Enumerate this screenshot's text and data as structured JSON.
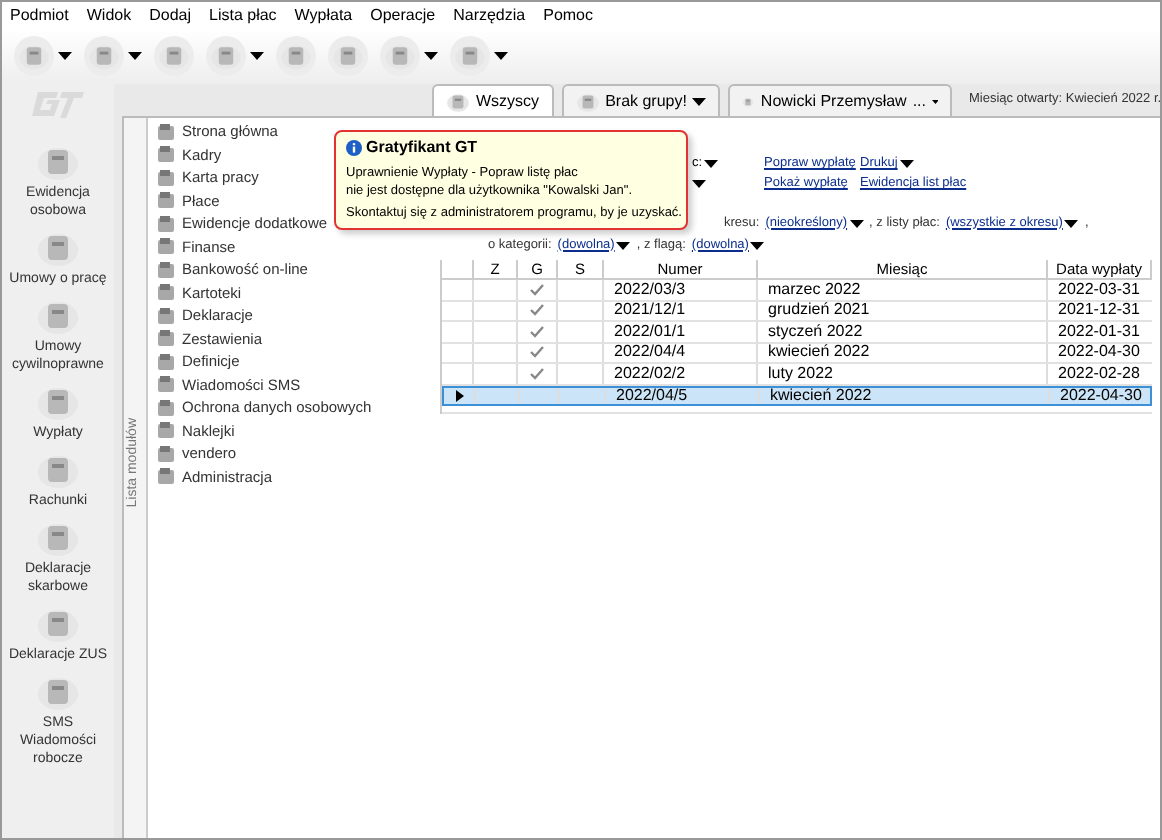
{
  "menu": [
    "Podmiot",
    "Widok",
    "Dodaj",
    "Lista płac",
    "Wypłata",
    "Operacje",
    "Narzędzia",
    "Pomoc"
  ],
  "tabs": [
    {
      "label": "Wszyscy",
      "selected": true,
      "dropdown": false
    },
    {
      "label": "Brak grupy!",
      "selected": false,
      "dropdown": true
    },
    {
      "label": "Nowicki Przemysław",
      "selected": false,
      "dropdown": true,
      "ellipsis": "..."
    }
  ],
  "open_month": "Miesiąc otwarty: Kwiecień 2022 r.",
  "left_nav": [
    "Ewidencja osobowa",
    "Umowy o pracę",
    "Umowy cywilnoprawne",
    "Wypłaty",
    "Rachunki",
    "Deklaracje skarbowe",
    "Deklaracje ZUS",
    "SMS Wiadomości robocze"
  ],
  "module_strip": {
    "label": "Lista modułów"
  },
  "modules": [
    "Strona główna",
    "Kadry",
    "Karta pracy",
    "Płace",
    "Ewidencje dodatkowe",
    "Finanse",
    "Bankowość on-line",
    "Kartoteki",
    "Deklaracje",
    "Zestawienia",
    "Definicje",
    "Wiadomości SMS",
    "Ochrona danych osobowych",
    "Naklejki",
    "vendero",
    "Administracja"
  ],
  "tooltip": {
    "title": "Gratyfikant GT",
    "message": "Uprawnienie Wypłaty - Popraw listę płac\nnie jest dostępne dla użytkownika \"Kowalski Jan\".",
    "hint": "Skontaktuj się z administratorem programu, by je uzyskać."
  },
  "actions": [
    {
      "partial": "c:",
      "links": [
        "Popraw wypłatę",
        "Drukuj"
      ]
    },
    {
      "links": [
        "Pokaż wypłatę",
        "Ewidencja list płac"
      ]
    }
  ],
  "filters": [
    [
      {
        "kind": "label",
        "text": "kresu:"
      },
      {
        "kind": "dropdown",
        "text": "(nieokreślony)"
      },
      {
        "kind": "label",
        "text": ", z listy płac:"
      },
      {
        "kind": "dropdown",
        "text": "(wszystkie z okresu)"
      },
      {
        "kind": "label",
        "text": ","
      }
    ],
    [
      {
        "kind": "label",
        "text": "o kategorii:"
      },
      {
        "kind": "dropdown",
        "text": "(dowolna)"
      },
      {
        "kind": "label",
        "text": ", z flagą:"
      },
      {
        "kind": "dropdown",
        "text": "(dowolna)"
      }
    ]
  ],
  "table": {
    "columns": [
      "Z",
      "G",
      "S",
      "Numer",
      "Miesiąc",
      "Data wypłaty"
    ],
    "rows": [
      {
        "g_checked": true,
        "numer": "2022/03/3",
        "miesiac": "marzec 2022",
        "data": "2022-03-31",
        "selected": false
      },
      {
        "g_checked": true,
        "numer": "2021/12/1",
        "miesiac": "grudzień 2021",
        "data": "2021-12-31",
        "selected": false
      },
      {
        "g_checked": true,
        "numer": "2022/01/1",
        "miesiac": "styczeń 2022",
        "data": "2022-01-31",
        "selected": false
      },
      {
        "g_checked": true,
        "numer": "2022/04/4",
        "miesiac": "kwiecień 2022",
        "data": "2022-04-30",
        "selected": false
      },
      {
        "g_checked": true,
        "numer": "2022/02/2",
        "miesiac": "luty 2022",
        "data": "2022-02-28",
        "selected": false
      },
      {
        "g_checked": false,
        "numer": "2022/04/5",
        "miesiac": "kwiecień 2022",
        "data": "2022-04-30",
        "selected": true
      }
    ]
  }
}
